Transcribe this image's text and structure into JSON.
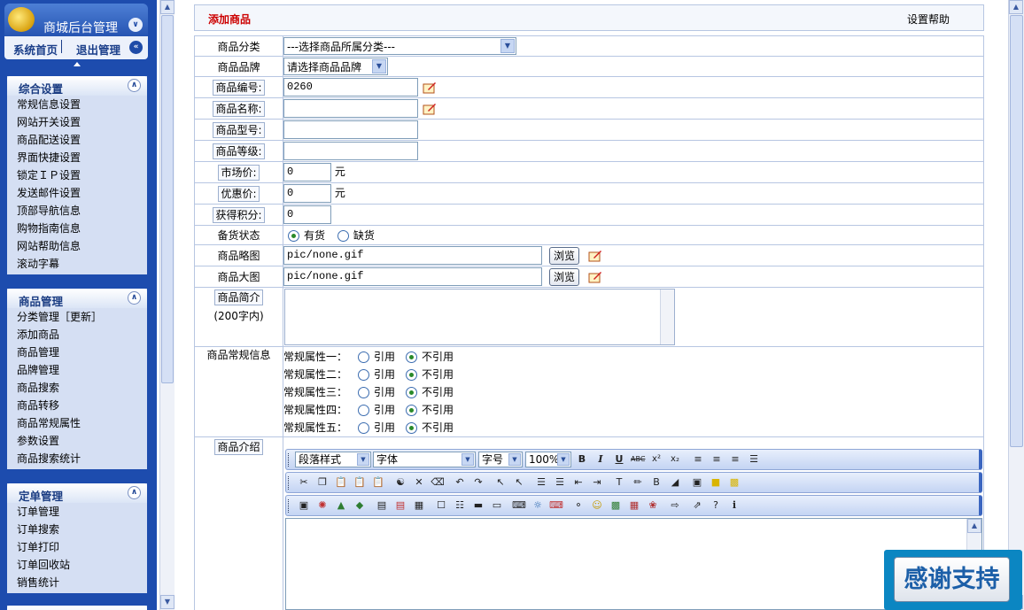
{
  "sidebar": {
    "app_title": "商城后台管理",
    "home_link": "系统首页",
    "logout_link": "退出管理",
    "groups": [
      {
        "title": "综合设置",
        "items": [
          "常规信息设置",
          "网站开关设置",
          "商品配送设置",
          "界面快捷设置",
          "锁定ＩＰ设置",
          "发送邮件设置",
          "顶部导航信息",
          "购物指南信息",
          "网站帮助信息",
          "滚动字幕"
        ]
      },
      {
        "title": "商品管理",
        "items": [
          "分类管理［更新］",
          "添加商品",
          "商品管理",
          "品牌管理",
          "商品搜索",
          "商品转移",
          "商品常规属性",
          "参数设置",
          "商品搜索统计"
        ]
      },
      {
        "title": "定单管理",
        "items": [
          "订单管理",
          "订单搜索",
          "订单打印",
          "订单回收站",
          "销售统计"
        ]
      }
    ]
  },
  "header": {
    "title": "添加商品",
    "help": "设置帮助"
  },
  "form": {
    "category": {
      "label": "商品分类",
      "value": "---选择商品所属分类---"
    },
    "brand": {
      "label": "商品品牌",
      "value": "请选择商品品牌"
    },
    "code": {
      "label": "商品编号:",
      "value": "0260"
    },
    "name": {
      "label": "商品名称:",
      "value": ""
    },
    "model": {
      "label": "商品型号:",
      "value": ""
    },
    "grade": {
      "label": "商品等级:",
      "value": ""
    },
    "market_price": {
      "label": "市场价:",
      "value": "0",
      "unit": "元"
    },
    "discount_price": {
      "label": "优惠价:",
      "value": "0",
      "unit": "元"
    },
    "points": {
      "label": "获得积分:",
      "value": "0"
    },
    "stock": {
      "label": "备货状态",
      "in_stock": "有货",
      "out_stock": "缺货",
      "selected": "有货"
    },
    "thumb": {
      "label": "商品略图",
      "value": "pic/none.gif",
      "browse": "浏览"
    },
    "bigpic": {
      "label": "商品大图",
      "value": "pic/none.gif",
      "browse": "浏览"
    },
    "brief": {
      "label": "商品简介",
      "hint": "(200字内)"
    },
    "attrs": {
      "label": "商品常规信息",
      "use": "引用",
      "nouse": "不引用",
      "rows": [
        "常规属性一：",
        "常规属性二：",
        "常规属性三：",
        "常规属性四：",
        "常规属性五："
      ]
    },
    "intro": {
      "label": "商品介绍"
    }
  },
  "editor": {
    "style": "段落样式",
    "font": "字体",
    "size": "字号",
    "zoom": "100%"
  },
  "badge": "感谢支持"
}
